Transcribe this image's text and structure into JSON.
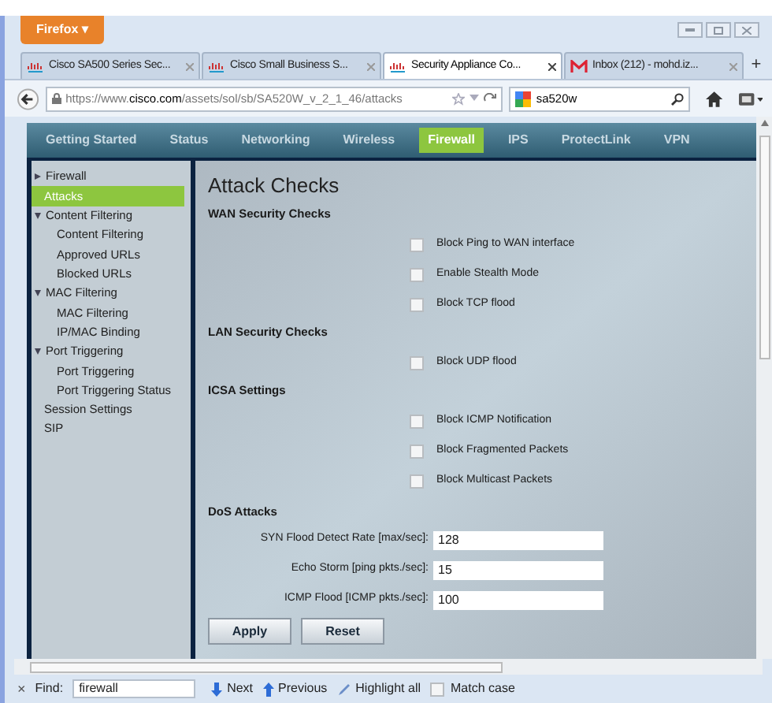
{
  "browser": {
    "menu_button": "Firefox ▾"
  },
  "tabs": [
    {
      "label": "Cisco SA500 Series Sec...",
      "kind": "cisco",
      "selected": false
    },
    {
      "label": "Cisco Small Business S...",
      "kind": "cisco",
      "selected": false
    },
    {
      "label": "Security Appliance Co...",
      "kind": "cisco",
      "selected": true
    },
    {
      "label": "Inbox (212) - mohd.iz...",
      "kind": "mail",
      "selected": false
    }
  ],
  "new_tab": "+",
  "address_bar": {
    "prefix": "https://www.",
    "domain": "cisco.com",
    "path": "/assets/sol/sb/SA520W_v_2_1_46/attacks"
  },
  "search_bar": {
    "value": "sa520w"
  },
  "nav": [
    {
      "label": "Getting Started",
      "selected": false
    },
    {
      "label": "Status",
      "selected": false
    },
    {
      "label": "Networking",
      "selected": false
    },
    {
      "label": "Wireless",
      "selected": false
    },
    {
      "label": "Firewall",
      "selected": true
    },
    {
      "label": "IPS",
      "selected": false
    },
    {
      "label": "ProtectLink",
      "selected": false
    },
    {
      "label": "VPN",
      "selected": false
    }
  ],
  "sidebar": {
    "items": [
      {
        "label": "Firewall",
        "expanded": false,
        "selected": false,
        "children": [
          {
            "label": "Attacks",
            "selected": true
          }
        ]
      },
      {
        "label": "Content Filtering",
        "expanded": true,
        "selected": false,
        "children": [
          {
            "label": "Content Filtering",
            "selected": false
          },
          {
            "label": "Approved URLs",
            "selected": false
          },
          {
            "label": "Blocked URLs",
            "selected": false
          }
        ]
      },
      {
        "label": "MAC Filtering",
        "expanded": true,
        "selected": false,
        "children": [
          {
            "label": "MAC Filtering",
            "selected": false
          },
          {
            "label": "IP/MAC Binding",
            "selected": false
          }
        ]
      },
      {
        "label": "Port Triggering",
        "expanded": true,
        "selected": false,
        "children": [
          {
            "label": "Port Triggering",
            "selected": false
          },
          {
            "label": "Port Triggering Status",
            "selected": false
          }
        ]
      },
      {
        "label": "Session Settings",
        "selected": false
      },
      {
        "label": "SIP",
        "selected": false
      }
    ]
  },
  "page_title": "Attack Checks",
  "sections": [
    {
      "title": "WAN Security Checks",
      "checks": [
        {
          "label": "Block Ping to WAN interface",
          "checked": false
        },
        {
          "label": "Enable Stealth Mode",
          "checked": false
        },
        {
          "label": "Block TCP flood",
          "checked": false
        }
      ]
    },
    {
      "title": "LAN Security Checks",
      "checks": [
        {
          "label": "Block UDP flood",
          "checked": false
        }
      ]
    },
    {
      "title": "ICSA Settings",
      "checks": [
        {
          "label": "Block ICMP Notification",
          "checked": false
        },
        {
          "label": "Block Fragmented Packets",
          "checked": false
        },
        {
          "label": "Block Multicast Packets",
          "checked": false
        }
      ]
    }
  ],
  "dos": {
    "title": "DoS Attacks",
    "fields": [
      {
        "label": "SYN Flood Detect Rate [max/sec]:",
        "value": "128"
      },
      {
        "label": "Echo Storm [ping pkts./sec]:",
        "value": "15"
      },
      {
        "label": "ICMP Flood [ICMP pkts./sec]:",
        "value": "100"
      }
    ]
  },
  "buttons": [
    "Apply",
    "Reset"
  ],
  "find_bar": {
    "close": "×",
    "label": "Find:",
    "value": "firewall",
    "next": "Next",
    "previous": "Previous",
    "highlight": "Highlight all",
    "match_case": {
      "label": "Match case",
      "checked": false
    }
  }
}
